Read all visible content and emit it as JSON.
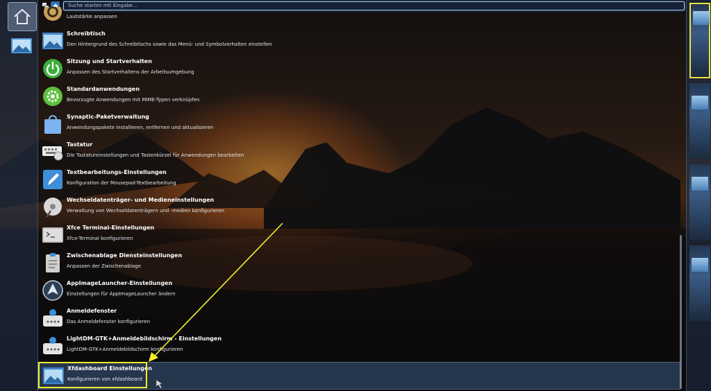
{
  "search": {
    "placeholder": "Suche starten mit Eingabe..."
  },
  "colors": {
    "highlight": "#f1ef2a",
    "search_border": "#9ecdf0",
    "accent": "#2f6fb0"
  },
  "icons": {
    "home": "home-icon",
    "windows_view": "windows-view-icon",
    "apps_view": "applications-view-icon"
  },
  "items": [
    {
      "title": "",
      "desc": "Lautstärke anpassen",
      "icon": "volume-icon"
    },
    {
      "title": "Schreibtisch",
      "desc": "Den Hintergrund des Schreibtischs sowie das Menü- und Symbolverhalten einstellen",
      "icon": "desktop-icon"
    },
    {
      "title": "Sitzung und Startverhalten",
      "desc": "Anpassen des Startverhaltens der Arbeitsumgebung",
      "icon": "power-icon"
    },
    {
      "title": "Standardanwendungen",
      "desc": "Bevorzugte Anwendungen mit MIME-Typen verknüpfen",
      "icon": "gear-icon"
    },
    {
      "title": "Synaptic-Paketverwaltung",
      "desc": "Anwendungspakete installieren, entfernen und aktualisieren",
      "icon": "package-bag-icon"
    },
    {
      "title": "Tastatur",
      "desc": "Die Tastatureinstellungen und Tastenkürzel für Anwendungen bearbeiten",
      "icon": "keyboard-icon"
    },
    {
      "title": "Textbearbeitungs-Einstellungen",
      "desc": "Konfiguration der Mousepad-Textbearbeitung",
      "icon": "text-editor-icon"
    },
    {
      "title": "Wechseldatenträger- und Medieneinstellungen",
      "desc": "Verwaltung von Wechseldatenträgern und -medien konfigurieren",
      "icon": "removable-media-icon"
    },
    {
      "title": "Xfce Terminal-Einstellungen",
      "desc": "Xfce-Terminal konfigurieren",
      "icon": "terminal-icon"
    },
    {
      "title": "Zwischenablage Diensteinstellungen",
      "desc": "Anpassen der Zwischenablage",
      "icon": "clipboard-icon"
    },
    {
      "title": "AppImageLauncher-Einstellungen",
      "desc": "Einstellungen für AppImageLauncher ändern",
      "icon": "appimage-icon"
    },
    {
      "title": "Anmeldefenster",
      "desc": "Das Anmeldefenster konfigurieren",
      "icon": "login-icon"
    },
    {
      "title": "LightDM-GTK+Anmeldebildschirm - Einstellungen",
      "desc": "LightDM-GTK+Anmeldebildschirm konfigurieren",
      "icon": "login-icon"
    },
    {
      "title": "Xfdashboard Einstellungen",
      "desc": "Konfigurieren von xfdashboard",
      "icon": "dashboard-icon",
      "selected": true
    }
  ]
}
